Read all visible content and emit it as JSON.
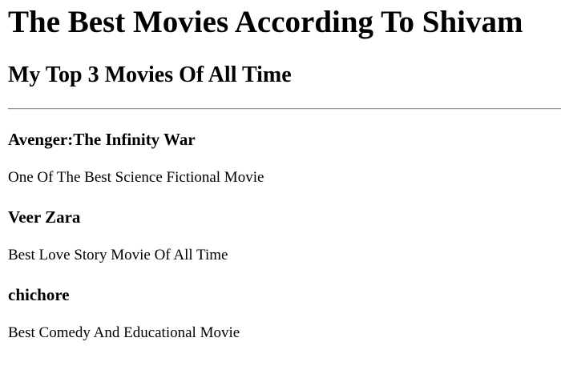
{
  "page": {
    "title": "The Best Movies According To Shivam",
    "subtitle": "My Top 3 Movies Of All Time"
  },
  "movies": [
    {
      "title": "Avenger:The Infinity War",
      "description": "One Of The Best Science Fictional Movie"
    },
    {
      "title": "Veer Zara",
      "description": "Best Love Story Movie Of All Time"
    },
    {
      "title": "chichore",
      "description": "Best Comedy And Educational Movie"
    }
  ]
}
